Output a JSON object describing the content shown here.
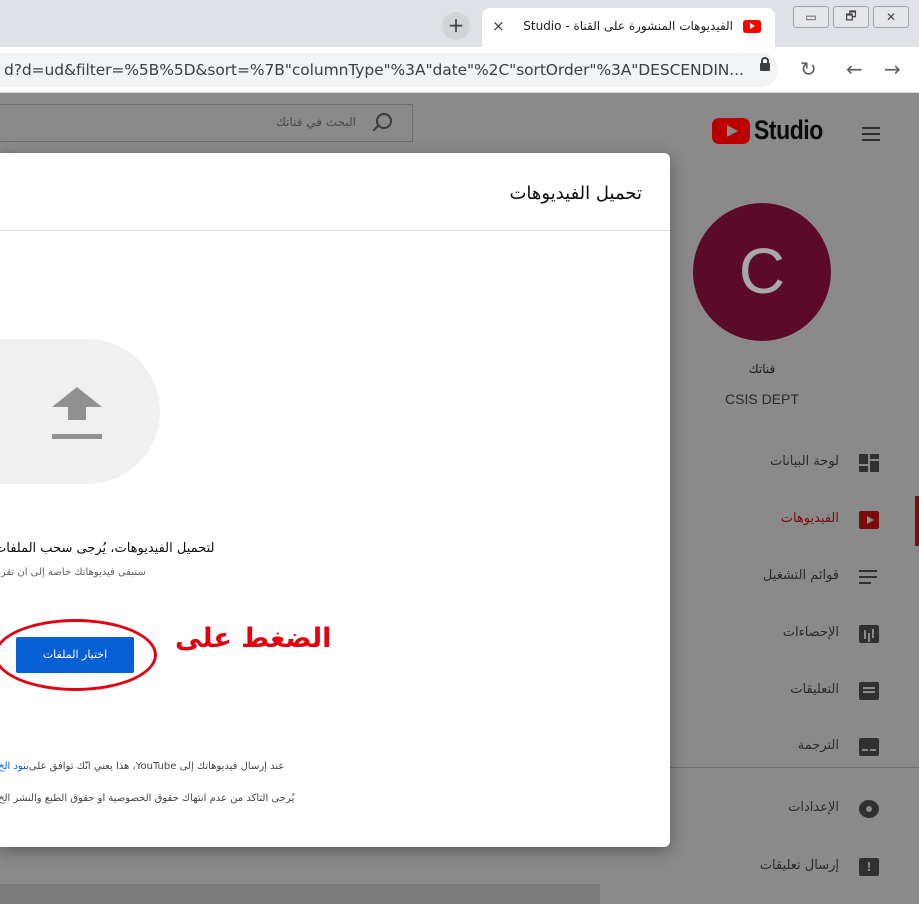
{
  "browser": {
    "tab_title": "الفيديوهات المنشورة على القناة - Studio",
    "tab_close": "×",
    "new_tab": "+",
    "url": "d?d=ud&filter=%5B%5D&sort=%7B\"columnType\"%3A\"date\"%2C\"sortOrder\"%3A\"DESCENDIN...",
    "nav": {
      "reload": "↻",
      "back": "←",
      "forward": "→"
    },
    "window_buttons": [
      "▭",
      "🗗",
      "✕"
    ]
  },
  "studio": {
    "search_placeholder": "البحث في قناتك",
    "logo_text": "Studio",
    "accent_color": "#ff0000"
  },
  "sidebar": {
    "avatar_letter": "C",
    "channel_label": "قناتك",
    "channel_name": "CSIS DEPT",
    "items": [
      {
        "label": "لوحة البيانات",
        "icon": "dashboard-icon"
      },
      {
        "label": "الفيديوهات",
        "icon": "videos-icon",
        "active": true
      },
      {
        "label": "قوائم التشغيل",
        "icon": "playlist-icon"
      },
      {
        "label": "الإحصاءات",
        "icon": "analytics-icon"
      },
      {
        "label": "التعليقات",
        "icon": "comments-icon"
      },
      {
        "label": "الترجمة",
        "icon": "subtitles-icon"
      },
      {
        "label": "الإعدادات",
        "icon": "gear-icon"
      },
      {
        "label": "إرسال تعليقات",
        "icon": "feedback-icon"
      }
    ]
  },
  "modal": {
    "title": "تحميل الفيديوهات",
    "drag_text": "لتحميل الفيديوهات، يُرجى سحب الملفات",
    "private_text": "ستبقى فيديوهاتك خاصة إلى أن تقرر",
    "select_button": "اختيار الملفات",
    "terms_text": "عند إرسال فيديوهاتك إلى YouTube، هذا يعني أنّك توافق على ",
    "terms_link": "بنود الخ",
    "copyright_text": "يُرجى التأكّد من عدم انتهاك حقوق الخصوصية أو حقوق الطبع والنشر الخ"
  },
  "annotation": {
    "text": "الضغط على",
    "color": "#e3000f"
  }
}
